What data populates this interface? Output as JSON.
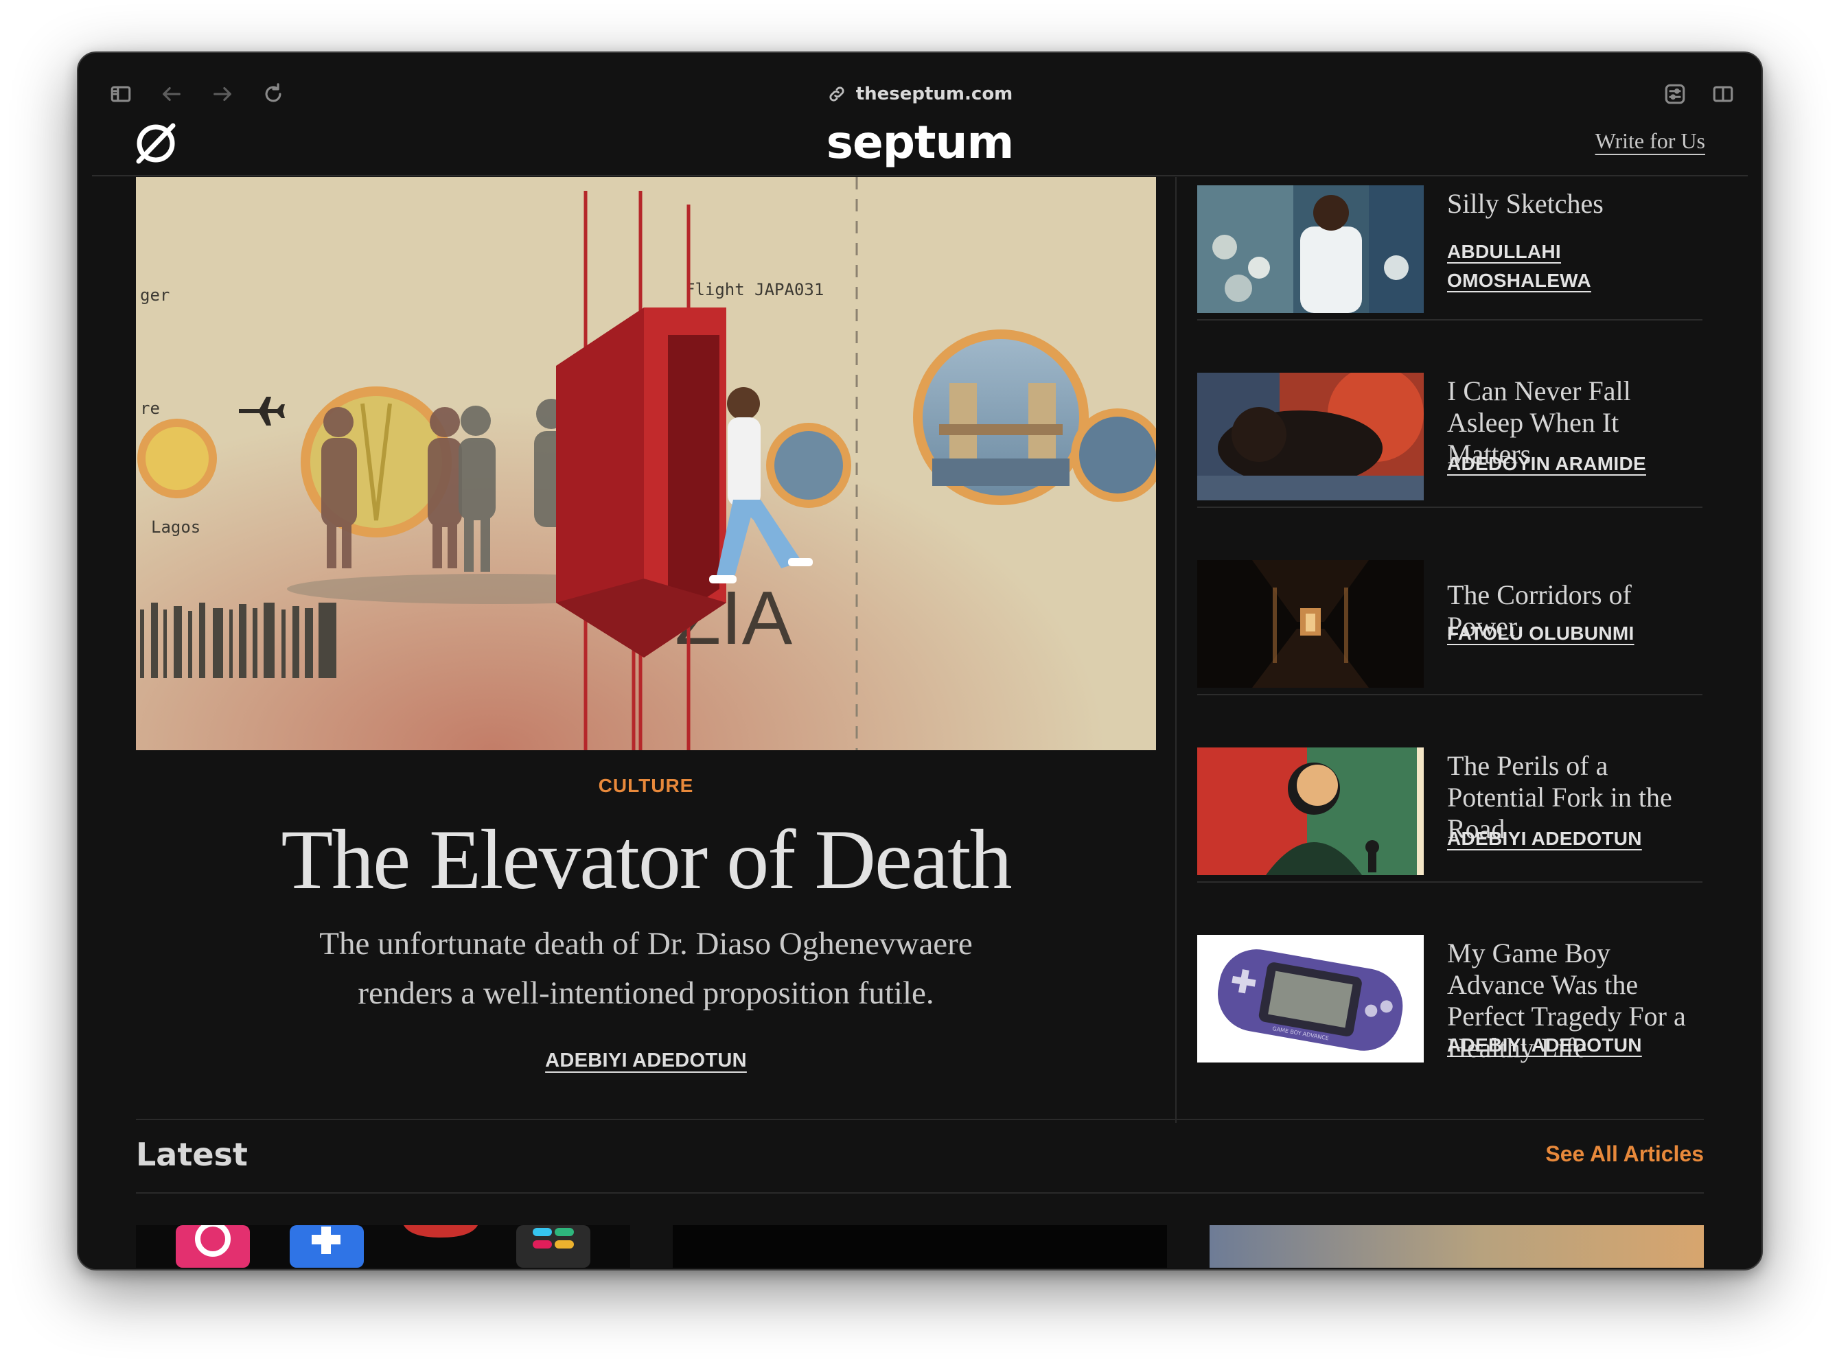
{
  "browser": {
    "url": "theseptum.com",
    "toolbar_icons": [
      "sidebar-icon",
      "back-arrow-icon",
      "forward-arrow-icon",
      "reload-icon",
      "link-icon",
      "reader-icon",
      "split-view-icon"
    ]
  },
  "site": {
    "brand": "septum",
    "write_for_us": "Write for Us",
    "accent_color": "#e8893b"
  },
  "hero": {
    "category": "CULTURE",
    "title": "The Elevator of Death",
    "subtitle": "The unfortunate death of Dr. Diaso Oghenevwaere renders a well-intentioned proposition futile.",
    "author": "ADEBIYI ADEDOTUN",
    "image_text": {
      "flight": "Flight JAPA031",
      "ger": "ger",
      "re": "re",
      "lagos": "Lagos",
      "gate": "ZIA"
    }
  },
  "side_articles": [
    {
      "title": "Silly Sketches",
      "author": "ABDULLAHI OMOSHALEWA"
    },
    {
      "title": "I Can Never Fall Asleep When It Matters",
      "author": "ADEDOYIN ARAMIDE"
    },
    {
      "title": "The Corridors of Power",
      "author": "FATOLU OLUBUNMI"
    },
    {
      "title": "The Perils of a Potential Fork in the Road",
      "author": "ADEBIYI ADEDOTUN"
    },
    {
      "title": "My Game Boy Advance Was the Perfect Tragedy For a Healthy Life",
      "author": "ADEBIYI ADEDOTUN"
    }
  ],
  "latest": {
    "heading": "Latest",
    "see_all": "See All Articles"
  },
  "gba_label": "GAME BOY ADVANCE"
}
